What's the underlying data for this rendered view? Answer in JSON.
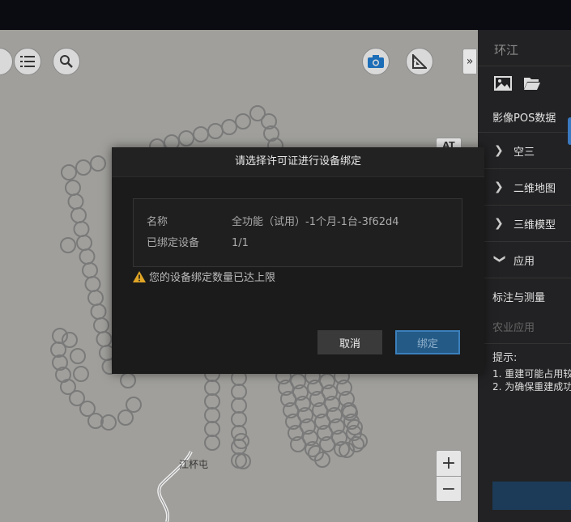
{
  "map": {
    "place_label": "江杯屯",
    "at_label": "AT",
    "expand_label": "»",
    "zoom_in_label": "+",
    "zoom_out_label": "−"
  },
  "sidebar": {
    "title": "环江",
    "section_label": "影像POS数据",
    "items": [
      {
        "label": "空三",
        "chevron": ">"
      },
      {
        "label": "二维地图",
        "chevron": ">"
      },
      {
        "label": "三维模型",
        "chevron": ">"
      },
      {
        "label": "应用",
        "chevron": "v"
      }
    ],
    "sub_items": [
      "标注与测量",
      "农业应用"
    ],
    "tips_title": "提示:",
    "tips": [
      "1. 重建可能占用较",
      "2. 为确保重建成功"
    ]
  },
  "modal": {
    "title": "请选择许可证进行设备绑定",
    "name_key": "名称",
    "name_value": "全功能（试用）-1个月-1台-3f62d4",
    "bound_key": "已绑定设备",
    "bound_value": "1/1",
    "warning": "您的设备绑定数量已达上限",
    "cancel_label": "取消",
    "bind_label": "绑定"
  },
  "colors": {
    "accent_blue": "#245a86",
    "warning_yellow": "#e0a526",
    "sidebar_bg": "#222224",
    "modal_bg": "#1b1b1b"
  }
}
